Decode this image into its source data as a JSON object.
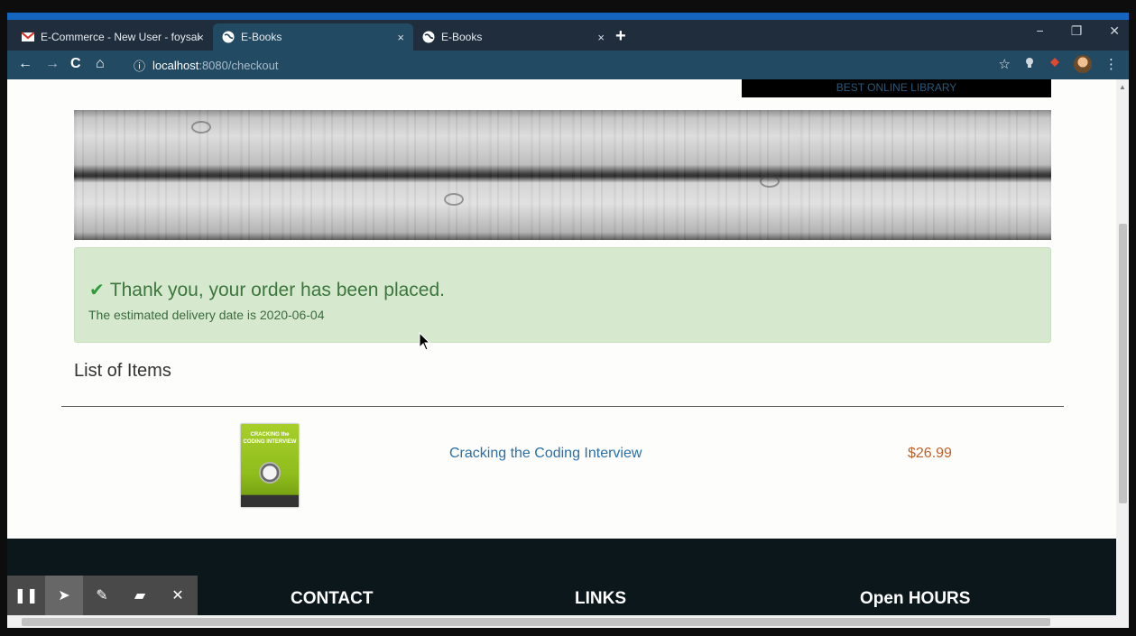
{
  "browser": {
    "tabs": [
      {
        "label": "E-Commerce - New User - foysal",
        "icon": "gmail-icon"
      },
      {
        "label": "E-Books",
        "icon": "globe-icon"
      },
      {
        "label": "E-Books",
        "icon": "globe-icon"
      }
    ],
    "tab_close": "×",
    "new_tab": "+",
    "window": {
      "minimize": "−",
      "restore": "❐",
      "close": "✕"
    },
    "nav": {
      "back": "←",
      "forward": "→",
      "reload": "C",
      "home": "⌂"
    },
    "address": {
      "host": "localhost",
      "path": ":8080/checkout",
      "info_icon": "ⓘ"
    },
    "toolbar_right": {
      "star": "☆",
      "menu": "⋮"
    }
  },
  "page": {
    "brand_banner": "BEST ONLINE LIBRARY",
    "alert": {
      "check": "✔",
      "headline": "Thank you, your order has been placed.",
      "delivery": "The estimated delivery date is 2020-06-04"
    },
    "list_title": "List of Items",
    "items": [
      {
        "book_cover_text": "CRACKING the CODING INTERVIEW",
        "title": "Cracking the Coding Interview",
        "price": "$26.99"
      }
    ],
    "footer": {
      "contact": "CONTACT",
      "links": "LINKS",
      "hours": "Open HOURS"
    }
  },
  "drawing_toolbar": {
    "pause": "❚❚",
    "pointer": "➤",
    "pen": "✎",
    "highlighter": "▰",
    "close": "✕"
  },
  "colors": {
    "alert_bg": "#d6e9cf",
    "alert_text": "#3c763d",
    "link": "#2a6fa6",
    "price": "#c0612a",
    "footer_bg": "#0b171b",
    "toolbar_bg": "#234a63"
  }
}
